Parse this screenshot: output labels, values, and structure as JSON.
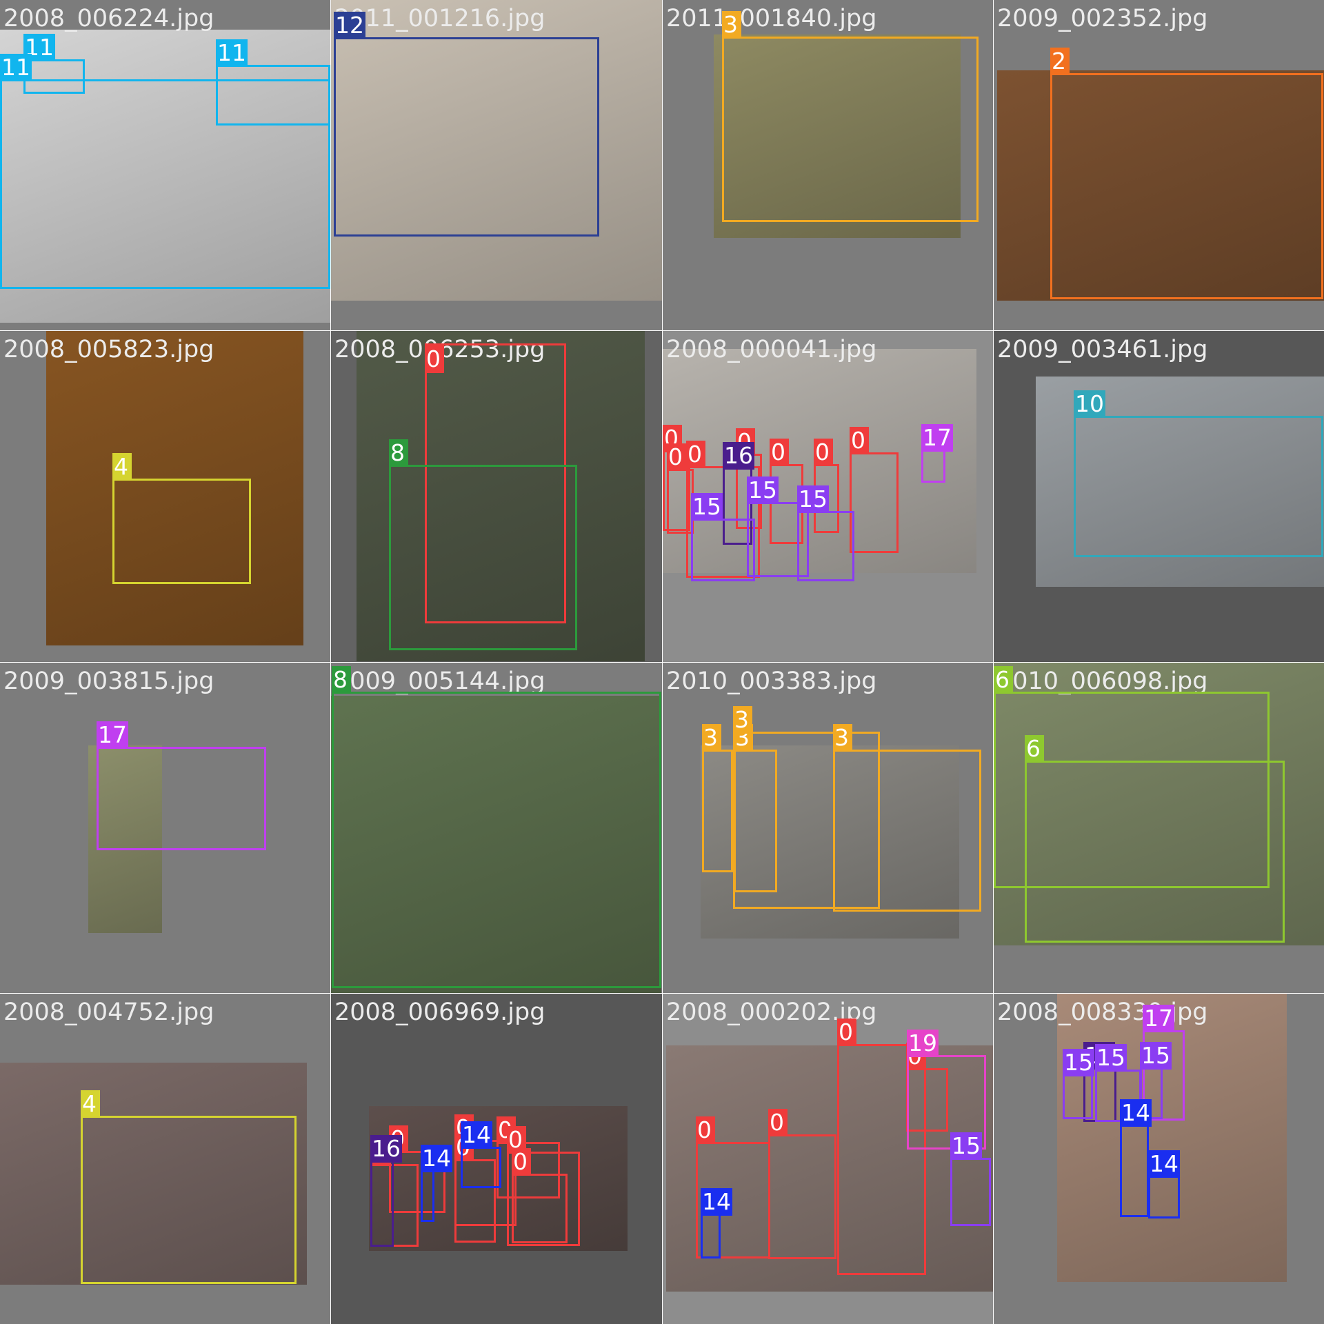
{
  "mosaic": {
    "tiles": [
      {
        "filename": "2008_006224.jpg",
        "bg": "#7c7c7c",
        "photo": "#d4d4d4",
        "boxes": [
          {
            "cls": "11",
            "color": "#11b5ee"
          },
          {
            "cls": "11",
            "color": "#11b5ee"
          },
          {
            "cls": "11",
            "color": "#11b5ee"
          }
        ]
      },
      {
        "filename": "2011_001216.jpg",
        "bg": "#7c7c7c",
        "photo": "#c9c0b3",
        "boxes": [
          {
            "cls": "12",
            "color": "#2b3f94"
          }
        ]
      },
      {
        "filename": "2011_001840.jpg",
        "bg": "#7c7c7c",
        "photo": "#8e8a62",
        "boxes": [
          {
            "cls": "3",
            "color": "#f2aa22"
          }
        ]
      },
      {
        "filename": "2009_002352.jpg",
        "bg": "#7c7c7c",
        "photo": "#7d5231",
        "boxes": [
          {
            "cls": "2",
            "color": "#f2701f"
          }
        ]
      },
      {
        "filename": "2008_005823.jpg",
        "bg": "#7c7c7c",
        "photo": "#875522",
        "boxes": [
          {
            "cls": "4",
            "color": "#d5d430"
          }
        ]
      },
      {
        "filename": "2008_006253.jpg",
        "bg": "#636363",
        "photo": "#525a48",
        "boxes": [
          {
            "cls": "0",
            "color": "#ef3b3b"
          },
          {
            "cls": "8",
            "color": "#2c9a3c"
          }
        ]
      },
      {
        "filename": "2008_000041.jpg",
        "bg": "#8d8d8d",
        "photo": "#b7b3ad",
        "boxes": [
          {
            "cls": "0",
            "color": "#ef3b3b"
          },
          {
            "cls": "0",
            "color": "#ef3b3b"
          },
          {
            "cls": "0",
            "color": "#ef3b3b"
          },
          {
            "cls": "0",
            "color": "#ef3b3b"
          },
          {
            "cls": "0",
            "color": "#ef3b3b"
          },
          {
            "cls": "0",
            "color": "#ef3b3b"
          },
          {
            "cls": "0",
            "color": "#ef3b3b"
          },
          {
            "cls": "16",
            "color": "#4a1d8d"
          },
          {
            "cls": "15",
            "color": "#8a3df2"
          },
          {
            "cls": "15",
            "color": "#8a3df2"
          },
          {
            "cls": "15",
            "color": "#8a3df2"
          },
          {
            "cls": "17",
            "color": "#c03ff0"
          }
        ]
      },
      {
        "filename": "2009_003461.jpg",
        "bg": "#575757",
        "photo": "#9a9fa3",
        "boxes": [
          {
            "cls": "10",
            "color": "#31a8bb"
          }
        ]
      },
      {
        "filename": "2009_003815.jpg",
        "bg": "#7c7c7c",
        "photo": "#8c8f6b",
        "boxes": [
          {
            "cls": "17",
            "color": "#c03ff0"
          }
        ]
      },
      {
        "filename": "2009_005144.jpg",
        "bg": "#7c7c7c",
        "photo": "#5f7350",
        "boxes": [
          {
            "cls": "8",
            "color": "#2c9a3c"
          }
        ]
      },
      {
        "filename": "2010_003383.jpg",
        "bg": "#7c7c7c",
        "photo": "#8c8a85",
        "boxes": [
          {
            "cls": "3",
            "color": "#f2aa22"
          },
          {
            "cls": "3",
            "color": "#f2aa22"
          },
          {
            "cls": "3",
            "color": "#f2aa22"
          },
          {
            "cls": "3",
            "color": "#f2aa22"
          }
        ]
      },
      {
        "filename": "2010_006098.jpg",
        "bg": "#7c7c7c",
        "photo": "#7f8a68",
        "boxes": [
          {
            "cls": "6",
            "color": "#8ec82f"
          },
          {
            "cls": "6",
            "color": "#8ec82f"
          }
        ]
      },
      {
        "filename": "2008_004752.jpg",
        "bg": "#7c7c7c",
        "photo": "#7b6a67",
        "boxes": [
          {
            "cls": "4",
            "color": "#d5d430"
          }
        ]
      },
      {
        "filename": "2008_006969.jpg",
        "bg": "#575757",
        "photo": "#5d4f4c",
        "boxes": [
          {
            "cls": "0",
            "color": "#ef3b3b"
          },
          {
            "cls": "0",
            "color": "#ef3b3b"
          },
          {
            "cls": "0",
            "color": "#ef3b3b"
          },
          {
            "cls": "0",
            "color": "#ef3b3b"
          },
          {
            "cls": "0",
            "color": "#ef3b3b"
          },
          {
            "cls": "0",
            "color": "#ef3b3b"
          },
          {
            "cls": "0",
            "color": "#ef3b3b"
          },
          {
            "cls": "16",
            "color": "#4a1d8d"
          },
          {
            "cls": "14",
            "color": "#1a2ef0"
          },
          {
            "cls": "14",
            "color": "#1a2ef0"
          }
        ]
      },
      {
        "filename": "2008_000202.jpg",
        "bg": "#8d8d8d",
        "photo": "#8a7a74",
        "boxes": [
          {
            "cls": "0",
            "color": "#ef3b3b"
          },
          {
            "cls": "0",
            "color": "#ef3b3b"
          },
          {
            "cls": "0",
            "color": "#ef3b3b"
          },
          {
            "cls": "0",
            "color": "#ef3b3b"
          },
          {
            "cls": "19",
            "color": "#e643c9"
          },
          {
            "cls": "15",
            "color": "#8a3df2"
          },
          {
            "cls": "14",
            "color": "#1a2ef0"
          }
        ]
      },
      {
        "filename": "2008_008330.jpg",
        "bg": "#7c7c7c",
        "photo": "#a88a78",
        "boxes": [
          {
            "cls": "17",
            "color": "#c03ff0"
          },
          {
            "cls": "16",
            "color": "#4a1d8d"
          },
          {
            "cls": "15",
            "color": "#8a3df2"
          },
          {
            "cls": "15",
            "color": "#8a3df2"
          },
          {
            "cls": "15",
            "color": "#8a3df2"
          },
          {
            "cls": "14",
            "color": "#1a2ef0"
          },
          {
            "cls": "14",
            "color": "#1a2ef0"
          }
        ]
      }
    ]
  }
}
